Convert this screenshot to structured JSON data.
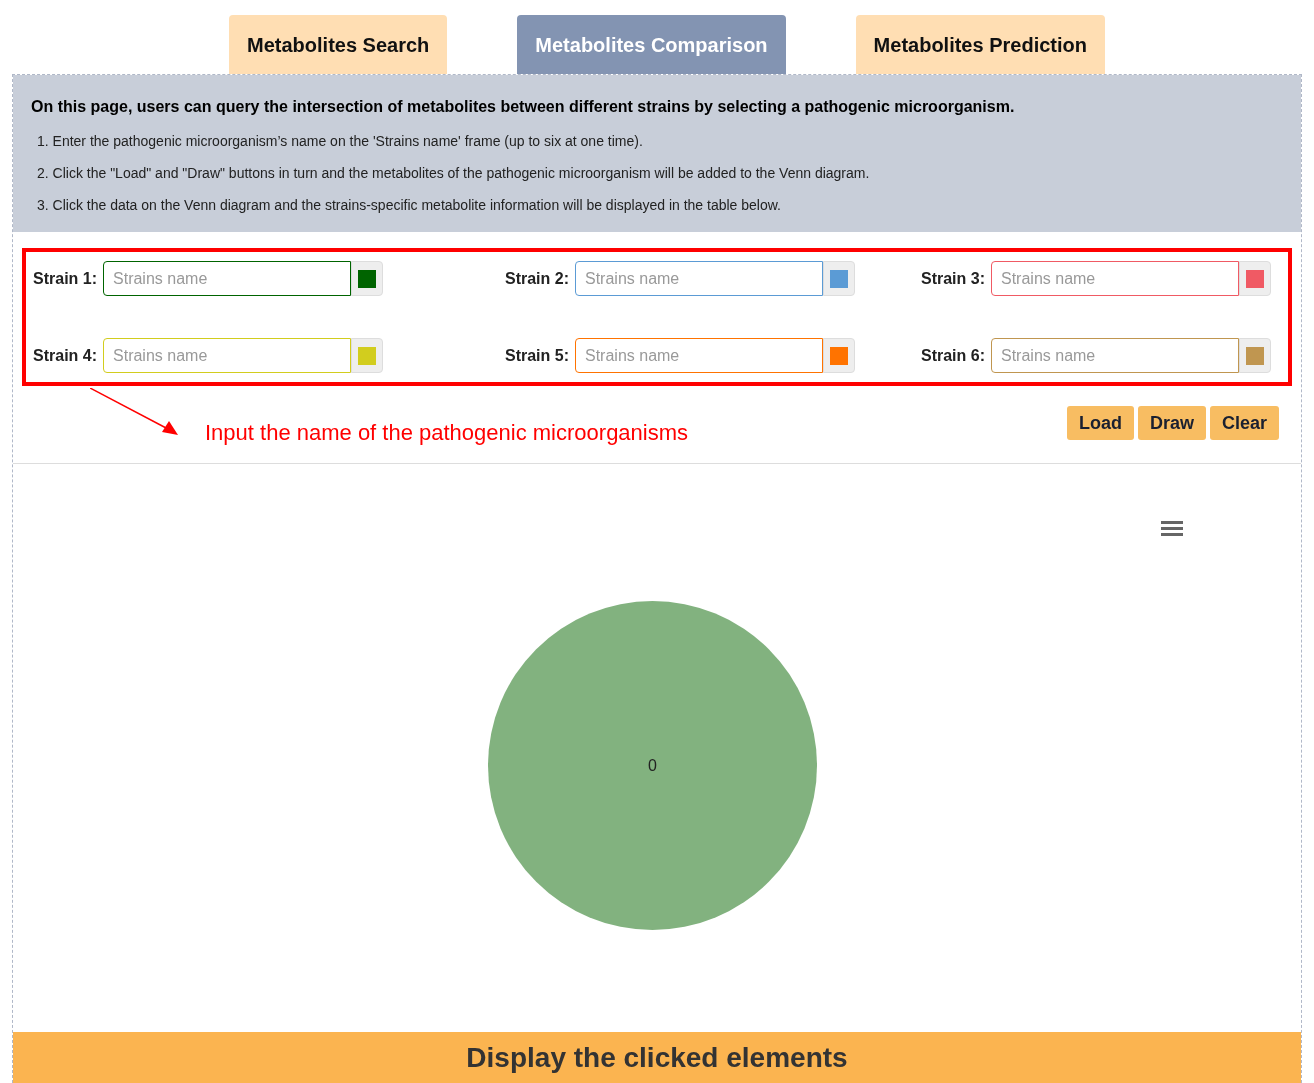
{
  "tabs": [
    {
      "label": "Metabolites Search",
      "selected": false
    },
    {
      "label": "Metabolites Comparison",
      "selected": true
    },
    {
      "label": "Metabolites Prediction",
      "selected": false
    }
  ],
  "intro": {
    "heading": "On this page, users can query the intersection of metabolites between different strains by selecting a pathogenic microorganism.",
    "steps": [
      "1. Enter the pathogenic microorganism’s name on the 'Strains name' frame (up to six at one time).",
      "2. Click the \"Load\" and \"Draw\" buttons in turn and the metabolites of the pathogenic microorganism will be added to the Venn diagram.",
      "3. Click the data on the Venn diagram and the strains-specific metabolite information will be displayed in the table below."
    ]
  },
  "strains": [
    {
      "label": "Strain 1:",
      "placeholder": "Strains name",
      "color": "#006400"
    },
    {
      "label": "Strain 2:",
      "placeholder": "Strains name",
      "color": "#5b9bd5"
    },
    {
      "label": "Strain 3:",
      "placeholder": "Strains name",
      "color": "#f05a64"
    },
    {
      "label": "Strain 4:",
      "placeholder": "Strains name",
      "color": "#d2cd1e"
    },
    {
      "label": "Strain 5:",
      "placeholder": "Strains name",
      "color": "#ff7300"
    },
    {
      "label": "Strain 6:",
      "placeholder": "Strains name",
      "color": "#c09650"
    }
  ],
  "annotation": "Input the name of the pathogenic microorganisms",
  "buttons": [
    "Load",
    "Draw",
    "Clear"
  ],
  "venn": {
    "label": "0"
  },
  "footer": "Display the clicked elements"
}
